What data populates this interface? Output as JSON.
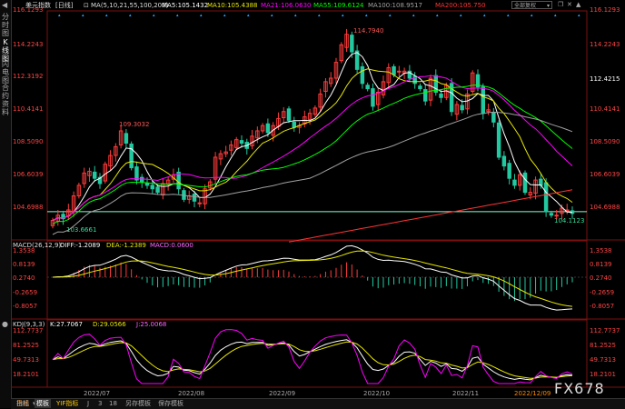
{
  "sidebar": {
    "tabs": [
      {
        "label": "分时图"
      },
      {
        "label": "K线图"
      },
      {
        "label": "闪电图"
      },
      {
        "label": "合约资料"
      }
    ]
  },
  "header": {
    "symbol": "美元指数",
    "period": "日线",
    "ma_title": "MA(5,10,21,55,100,200)",
    "ma_items": [
      {
        "label": "MA5:105.1432",
        "color": "#ffffff"
      },
      {
        "label": "MA10:105.4388",
        "color": "#e6e600"
      },
      {
        "label": "MA21:106.0630",
        "color": "#ff00ff"
      },
      {
        "label": "MA55:109.6124",
        "color": "#00ff00"
      },
      {
        "label": "MA100:108.9517",
        "color": "#a0a0a0"
      },
      {
        "label": "MA200:105.750",
        "color": "#ff3333"
      }
    ],
    "search_value": "全部复权"
  },
  "price_axis": {
    "ticks": [
      "116.1293",
      "114.2243",
      "112.3192",
      "110.4141",
      "108.5090",
      "106.6039",
      "104.6988"
    ],
    "tick_values": [
      116.1293,
      114.2243,
      112.3192,
      110.4141,
      108.509,
      106.6039,
      104.6988
    ],
    "current_price": "112.4215",
    "annotations": [
      "114.7940",
      "109.3032",
      "103.6661",
      "104.1123"
    ]
  },
  "macd": {
    "title": "MACD(26,12,9)",
    "diff": "DIFF:-1.2089",
    "dea": "DEA:-1.2389",
    "macd": "MACD:0.0600",
    "ticks": [
      "1.3538",
      "0.8139",
      "0.2740",
      "-0.2659",
      "-0.8057"
    ],
    "tick_values": [
      1.3538,
      0.8139,
      0.274,
      -0.2659,
      -0.8057
    ]
  },
  "kdj": {
    "title": "KDJ(9,3,3)",
    "k": "K:27.7067",
    "d": "D:29.0566",
    "j": "J:25.0068",
    "ticks": [
      "112.7737",
      "81.2525",
      "49.7313",
      "18.2101"
    ],
    "tick_values": [
      112.7737,
      81.2525,
      49.7313,
      18.2101
    ]
  },
  "x_axis": {
    "labels": [
      "2022/07",
      "2022/08",
      "2022/09",
      "2022/10",
      "2022/11",
      "2022/12/09"
    ]
  },
  "bottom_bar": {
    "items": [
      "日线",
      "指标",
      "模板",
      "YIF指标",
      "J",
      "3",
      "18",
      "另存模板",
      "保存模板"
    ]
  },
  "watermark": "FX678",
  "colors": {
    "up": "#ff3b3b",
    "down": "#22c9a0",
    "ma5": "#ffffff",
    "ma10": "#e6e600",
    "ma21": "#ff00ff",
    "ma55": "#00ff00",
    "ma100": "#a0a0a0",
    "ma200": "#ff3333",
    "support": "#7fffd4",
    "axis": "#ff4444"
  },
  "chart_data": {
    "type": "candlestick",
    "series": [
      {
        "name": "price",
        "key": "close_path",
        "values": [
          104.2,
          104.5,
          104.3,
          104.8,
          105.6,
          106.2,
          106.9,
          107.0,
          106.6,
          106.3,
          107.4,
          107.9,
          108.4,
          109.3,
          108.6,
          107.2,
          106.5,
          106.4,
          106.2,
          106.0,
          105.8,
          106.3,
          106.5,
          106.8,
          106.0,
          105.4,
          105.6,
          105.3,
          105.2,
          106.0,
          106.4,
          107.8,
          108.0,
          108.1,
          108.5,
          108.8,
          108.6,
          108.3,
          109.0,
          109.3,
          109.6,
          109.2,
          109.6,
          110.0,
          110.4,
          109.9,
          109.5,
          109.6,
          110.1,
          110.3,
          110.6,
          111.4,
          112.1,
          112.3,
          113.2,
          114.2,
          114.8,
          113.8,
          112.8,
          112.0,
          111.7,
          110.7,
          111.5,
          112.1,
          112.9,
          112.5,
          112.7,
          112.7,
          112.3,
          112.0,
          111.7,
          111.0,
          112.3,
          111.5,
          111.2,
          111.9,
          110.4,
          110.8,
          110.5,
          111.4,
          112.6,
          111.8,
          110.3,
          110.5,
          109.8,
          107.8,
          107.3,
          106.6,
          106.2,
          106.8,
          105.8,
          105.8,
          106.5,
          106.2,
          104.7,
          104.5,
          104.5,
          104.9,
          104.8,
          104.6
        ]
      }
    ],
    "ma_series": [
      {
        "name": "MA5",
        "last": 105.1432
      },
      {
        "name": "MA10",
        "last": 105.4388
      },
      {
        "name": "MA21",
        "last": 106.063
      },
      {
        "name": "MA55",
        "last": 109.6124
      },
      {
        "name": "MA100",
        "last": 108.9517
      },
      {
        "name": "MA200",
        "last": 105.75
      }
    ],
    "high": 114.794,
    "low": 103.6661,
    "local_high_jul": 109.3032,
    "recent_low": 104.1123,
    "ylim": [
      103.4,
      116.13
    ],
    "x_labels": [
      "2022/07",
      "2022/08",
      "2022/09",
      "2022/10",
      "2022/11",
      "2022/12/09"
    ]
  }
}
